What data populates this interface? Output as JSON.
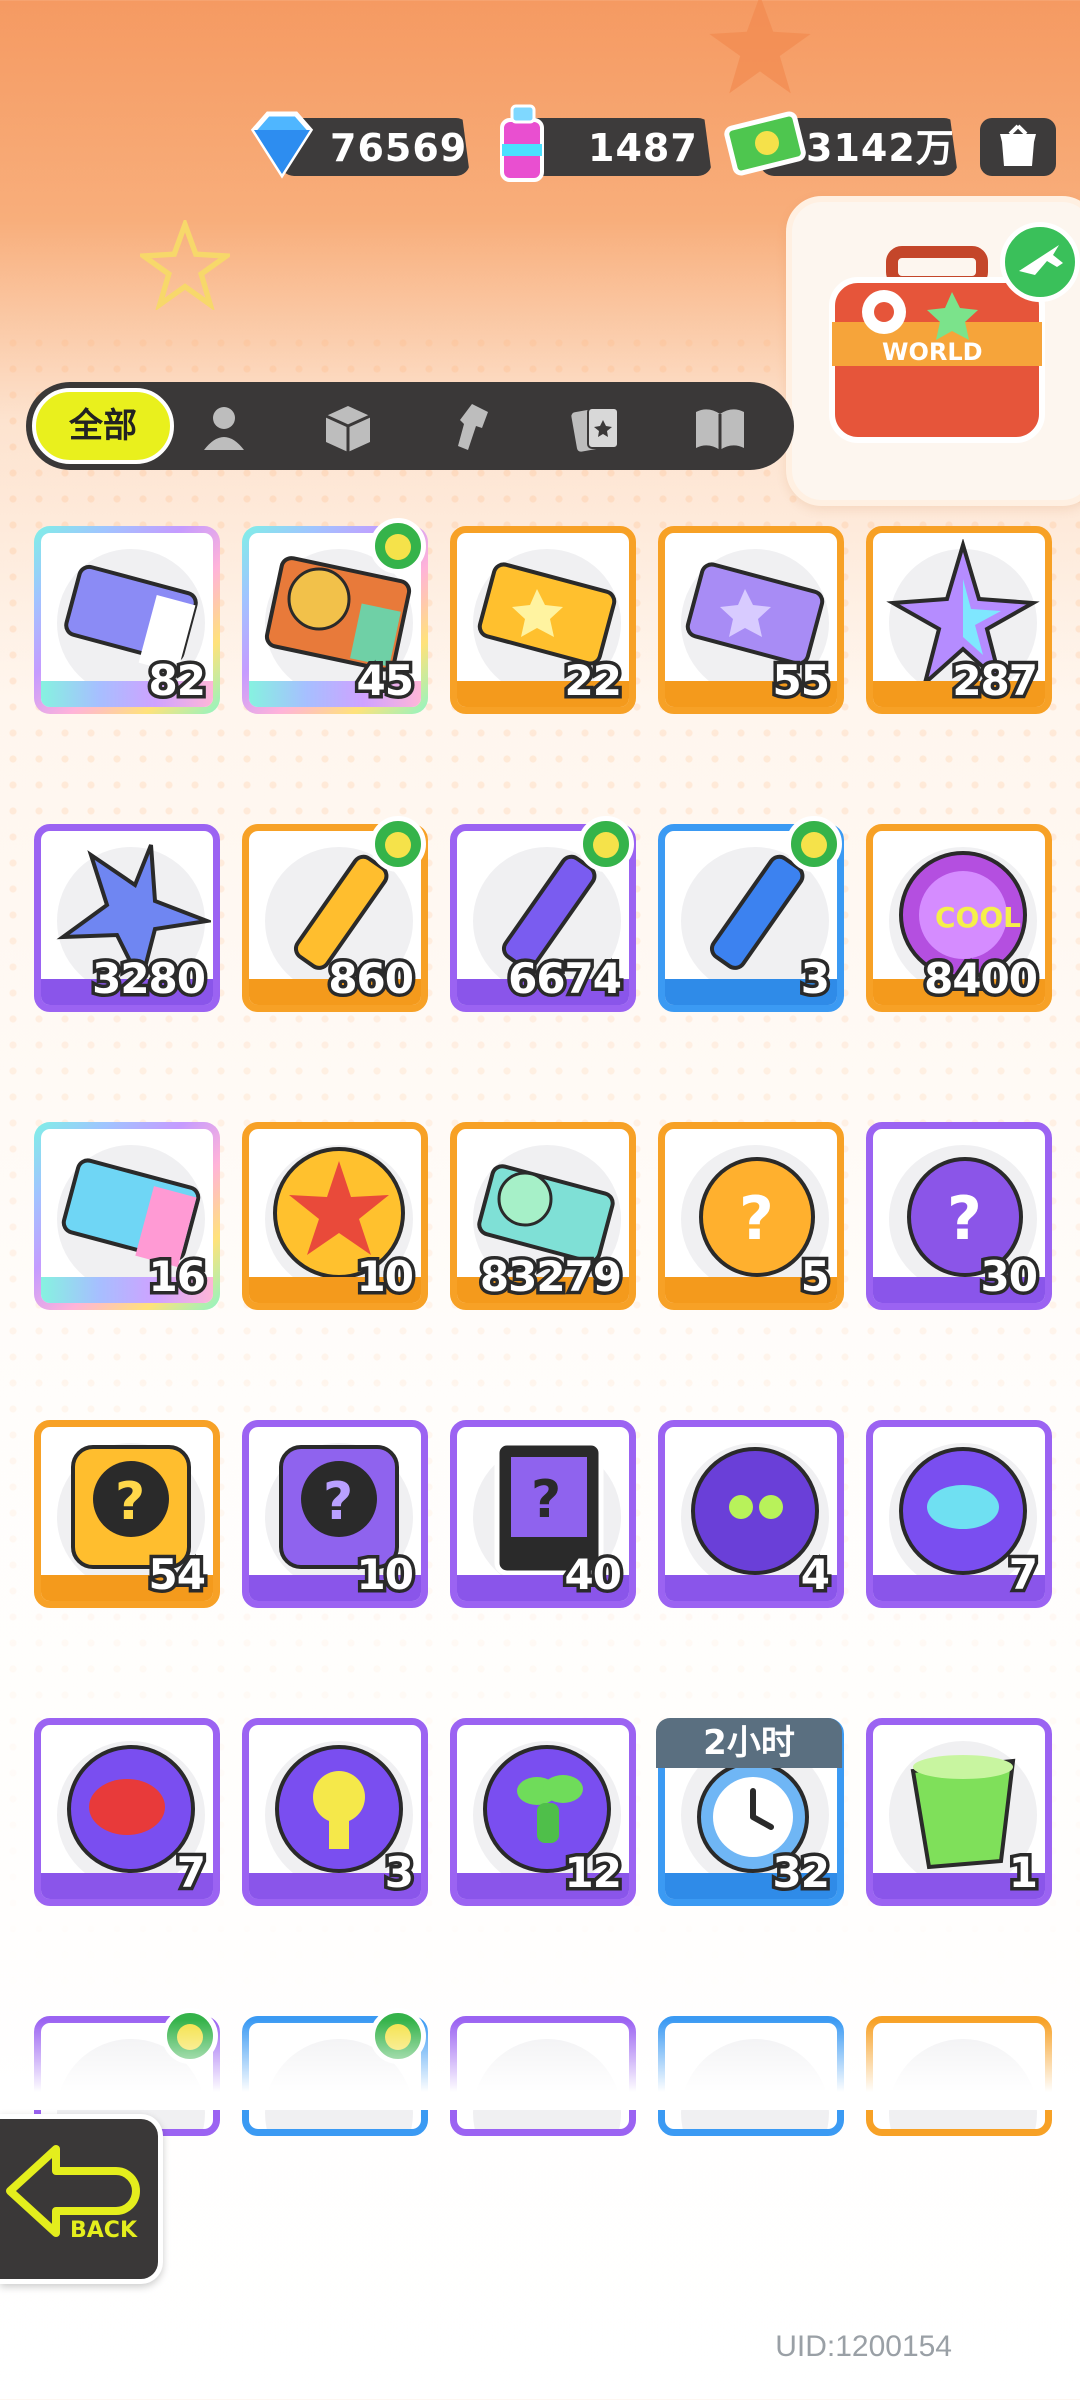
{
  "currencies": [
    {
      "name": "diamond-icon",
      "value": "76569"
    },
    {
      "name": "spray-can-icon",
      "value": "1487"
    },
    {
      "name": "cash-icon",
      "value": "3142万"
    }
  ],
  "tabs": {
    "all_label": "全部",
    "icons": [
      "person-icon",
      "box-icon",
      "spray-gun-icon",
      "card-icon",
      "book-icon"
    ]
  },
  "travel_card": {
    "label": "WORLD"
  },
  "items": [
    {
      "name": "deity-ticket",
      "count": "82"
    },
    {
      "name": "lion-card",
      "count": "45"
    },
    {
      "name": "star-ticket",
      "count": "22"
    },
    {
      "name": "purple-star-ticket",
      "count": "55"
    },
    {
      "name": "rainbow-star",
      "count": "287"
    },
    {
      "name": "blue-star",
      "count": "3280"
    },
    {
      "name": "yellow-crayon",
      "count": "860"
    },
    {
      "name": "purple-crayon",
      "count": "6674"
    },
    {
      "name": "blue-crayon",
      "count": "3"
    },
    {
      "name": "cool-coin",
      "count": "8400"
    },
    {
      "name": "lottery-ticket",
      "count": "16"
    },
    {
      "name": "burst-badge",
      "count": "10"
    },
    {
      "name": "season-ticket",
      "count": "83279"
    },
    {
      "name": "orange-mystery-egg",
      "count": "5"
    },
    {
      "name": "purple-mystery-egg",
      "count": "30"
    },
    {
      "name": "deity-mystery-orange",
      "count": "54"
    },
    {
      "name": "deity-mystery-purple",
      "count": "10"
    },
    {
      "name": "travel-mystery-card",
      "count": "40"
    },
    {
      "name": "bat-sphere",
      "count": "4"
    },
    {
      "name": "fish-sphere",
      "count": "7"
    },
    {
      "name": "piranha-sphere",
      "count": "7"
    },
    {
      "name": "jelly-sphere",
      "count": "3"
    },
    {
      "name": "plant-sphere",
      "count": "12"
    },
    {
      "name": "alarm-clock",
      "count": "32",
      "timer": "2小时"
    },
    {
      "name": "green-cup",
      "count": "1"
    }
  ],
  "back_label": "BACK",
  "uid": "UID:1200154"
}
